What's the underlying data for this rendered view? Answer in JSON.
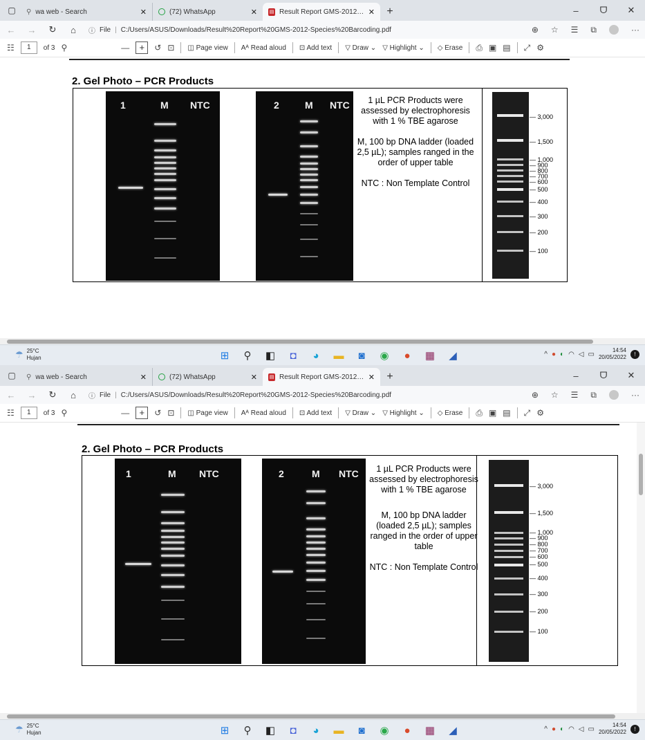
{
  "browser": {
    "tabs": [
      {
        "title": "wa web - Search",
        "icon": "search-icon"
      },
      {
        "title": "(72) WhatsApp",
        "icon": "whatsapp-icon"
      },
      {
        "title": "Result Report GMS-2012-Species",
        "icon": "pdf-icon",
        "active": true
      }
    ],
    "new_tab": "+",
    "url_label": "File",
    "url": "C:/Users/ASUS/Downloads/Result%20Report%20GMS-2012-Species%20Barcoding.pdf"
  },
  "pdf_toolbar": {
    "page_current": "1",
    "page_total": "of 3",
    "page_view": "Page view",
    "read_aloud": "Read aloud",
    "add_text": "Add text",
    "draw": "Draw",
    "highlight": "Highlight",
    "erase": "Erase"
  },
  "document": {
    "section_title": "2.  Gel Photo – PCR Products",
    "gel1": {
      "lane1": "1",
      "lane2": "M",
      "lane3": "NTC"
    },
    "gel2": {
      "lane1": "2",
      "lane2": "M",
      "lane3": "NTC"
    },
    "desc1": "1 µL PCR Products were assessed by electrophoresis with 1 % TBE agarose",
    "desc2": "M, 100 bp DNA ladder (loaded 2,5 µL); samples ranged in the order of upper table",
    "desc3": "NTC : Non Template Control",
    "ladder_sizes": [
      "3,000",
      "1,500",
      "1,000",
      "900",
      "800",
      "700",
      "600",
      "500",
      "400",
      "300",
      "200",
      "100"
    ]
  },
  "taskbar": {
    "temperature": "25°C",
    "weather": "Hujan",
    "time": "14:54",
    "date": "20/05/2022"
  }
}
